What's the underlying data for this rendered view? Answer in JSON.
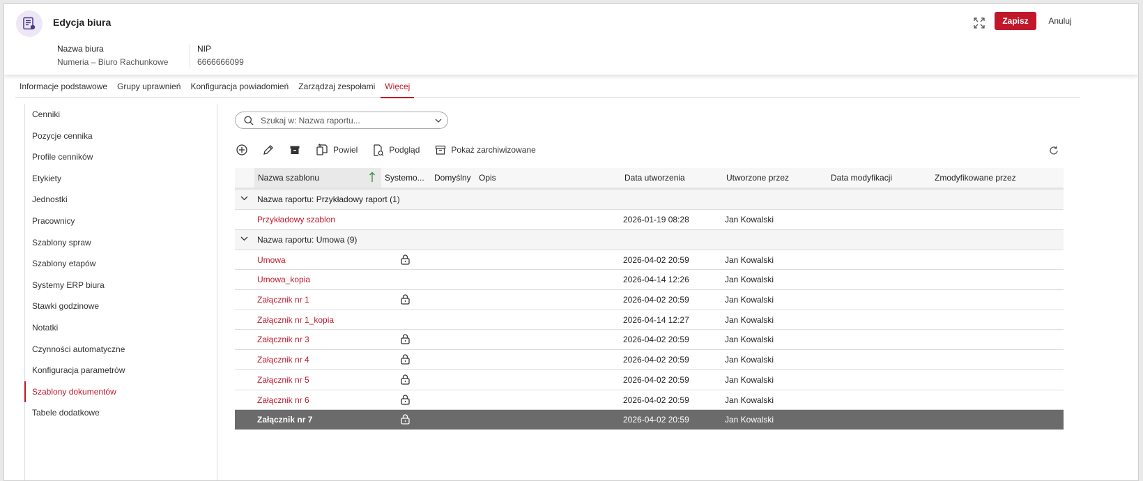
{
  "header": {
    "title": "Edycja biura",
    "office_name_label": "Nazwa biura",
    "office_name_value": "Numeria – Biuro Rachunkowe",
    "nip_label": "NIP",
    "nip_value": "6666666099",
    "save_label": "Zapisz",
    "cancel_label": "Anuluj",
    "icon": "office-icon",
    "accent_color": "#c0182a"
  },
  "tabs": [
    {
      "label": "Informacje podstawowe",
      "active": false
    },
    {
      "label": "Grupy uprawnień",
      "active": false
    },
    {
      "label": "Konfiguracja powiadomień",
      "active": false
    },
    {
      "label": "Zarządzaj zespołami",
      "active": false
    },
    {
      "label": "Więcej",
      "active": true
    }
  ],
  "sidebar": {
    "items": [
      {
        "label": "Cenniki",
        "active": false
      },
      {
        "label": "Pozycje cennika",
        "active": false
      },
      {
        "label": "Profile cenników",
        "active": false
      },
      {
        "label": "Etykiety",
        "active": false
      },
      {
        "label": "Jednostki",
        "active": false
      },
      {
        "label": "Pracownicy",
        "active": false
      },
      {
        "label": "Szablony spraw",
        "active": false
      },
      {
        "label": "Szablony etapów",
        "active": false
      },
      {
        "label": "Systemy ERP biura",
        "active": false
      },
      {
        "label": "Stawki godzinowe",
        "active": false
      },
      {
        "label": "Notatki",
        "active": false
      },
      {
        "label": "Czynności automatyczne",
        "active": false
      },
      {
        "label": "Konfiguracja parametrów",
        "active": false
      },
      {
        "label": "Szablony dokumentów",
        "active": true
      },
      {
        "label": "Tabele dodatkowe",
        "active": false
      }
    ]
  },
  "search": {
    "placeholder": "Szukaj w: Nazwa raportu..."
  },
  "toolbar": {
    "copy_label": "Powiel",
    "preview_label": "Podgląd",
    "show_archived_label": "Pokaż zarchiwizowane"
  },
  "grid": {
    "columns": [
      {
        "key": "name",
        "label": "Nazwa szablonu"
      },
      {
        "key": "system",
        "label": "Systemo..."
      },
      {
        "key": "default",
        "label": "Domyślny"
      },
      {
        "key": "desc",
        "label": "Opis"
      },
      {
        "key": "created",
        "label": "Data utworzenia"
      },
      {
        "key": "created_by",
        "label": "Utworzone przez"
      },
      {
        "key": "modified",
        "label": "Data modyfikacji"
      },
      {
        "key": "modified_by",
        "label": "Zmodyfikowane przez"
      }
    ],
    "sort": {
      "column": "name",
      "direction": "ascending"
    },
    "groups": [
      {
        "label": "Nazwa raportu: Przykładowy raport (1)",
        "rows": [
          {
            "name": "Przykładowy szablon",
            "system": false,
            "created": "2026-01-19 08:28",
            "created_by": "Jan Kowalski",
            "selected": false
          }
        ]
      },
      {
        "label": "Nazwa raportu: Umowa (9)",
        "rows": [
          {
            "name": "Umowa",
            "system": true,
            "created": "2026-04-02 20:59",
            "created_by": "Jan Kowalski",
            "selected": false
          },
          {
            "name": "Umowa_kopia",
            "system": false,
            "created": "2026-04-14 12:26",
            "created_by": "Jan Kowalski",
            "selected": false
          },
          {
            "name": "Załącznik nr 1",
            "system": true,
            "created": "2026-04-02 20:59",
            "created_by": "Jan Kowalski",
            "selected": false
          },
          {
            "name": "Załącznik nr 1_kopia",
            "system": false,
            "created": "2026-04-14 12:27",
            "created_by": "Jan Kowalski",
            "selected": false
          },
          {
            "name": "Załącznik nr 3",
            "system": true,
            "created": "2026-04-02 20:59",
            "created_by": "Jan Kowalski",
            "selected": false
          },
          {
            "name": "Załącznik nr 4",
            "system": true,
            "created": "2026-04-02 20:59",
            "created_by": "Jan Kowalski",
            "selected": false
          },
          {
            "name": "Załącznik nr 5",
            "system": true,
            "created": "2026-04-02 20:59",
            "created_by": "Jan Kowalski",
            "selected": false
          },
          {
            "name": "Załącznik nr 6",
            "system": true,
            "created": "2026-04-02 20:59",
            "created_by": "Jan Kowalski",
            "selected": false
          },
          {
            "name": "Załącznik nr 7",
            "system": true,
            "created": "2026-04-02 20:59",
            "created_by": "Jan Kowalski",
            "selected": true
          }
        ]
      }
    ]
  }
}
